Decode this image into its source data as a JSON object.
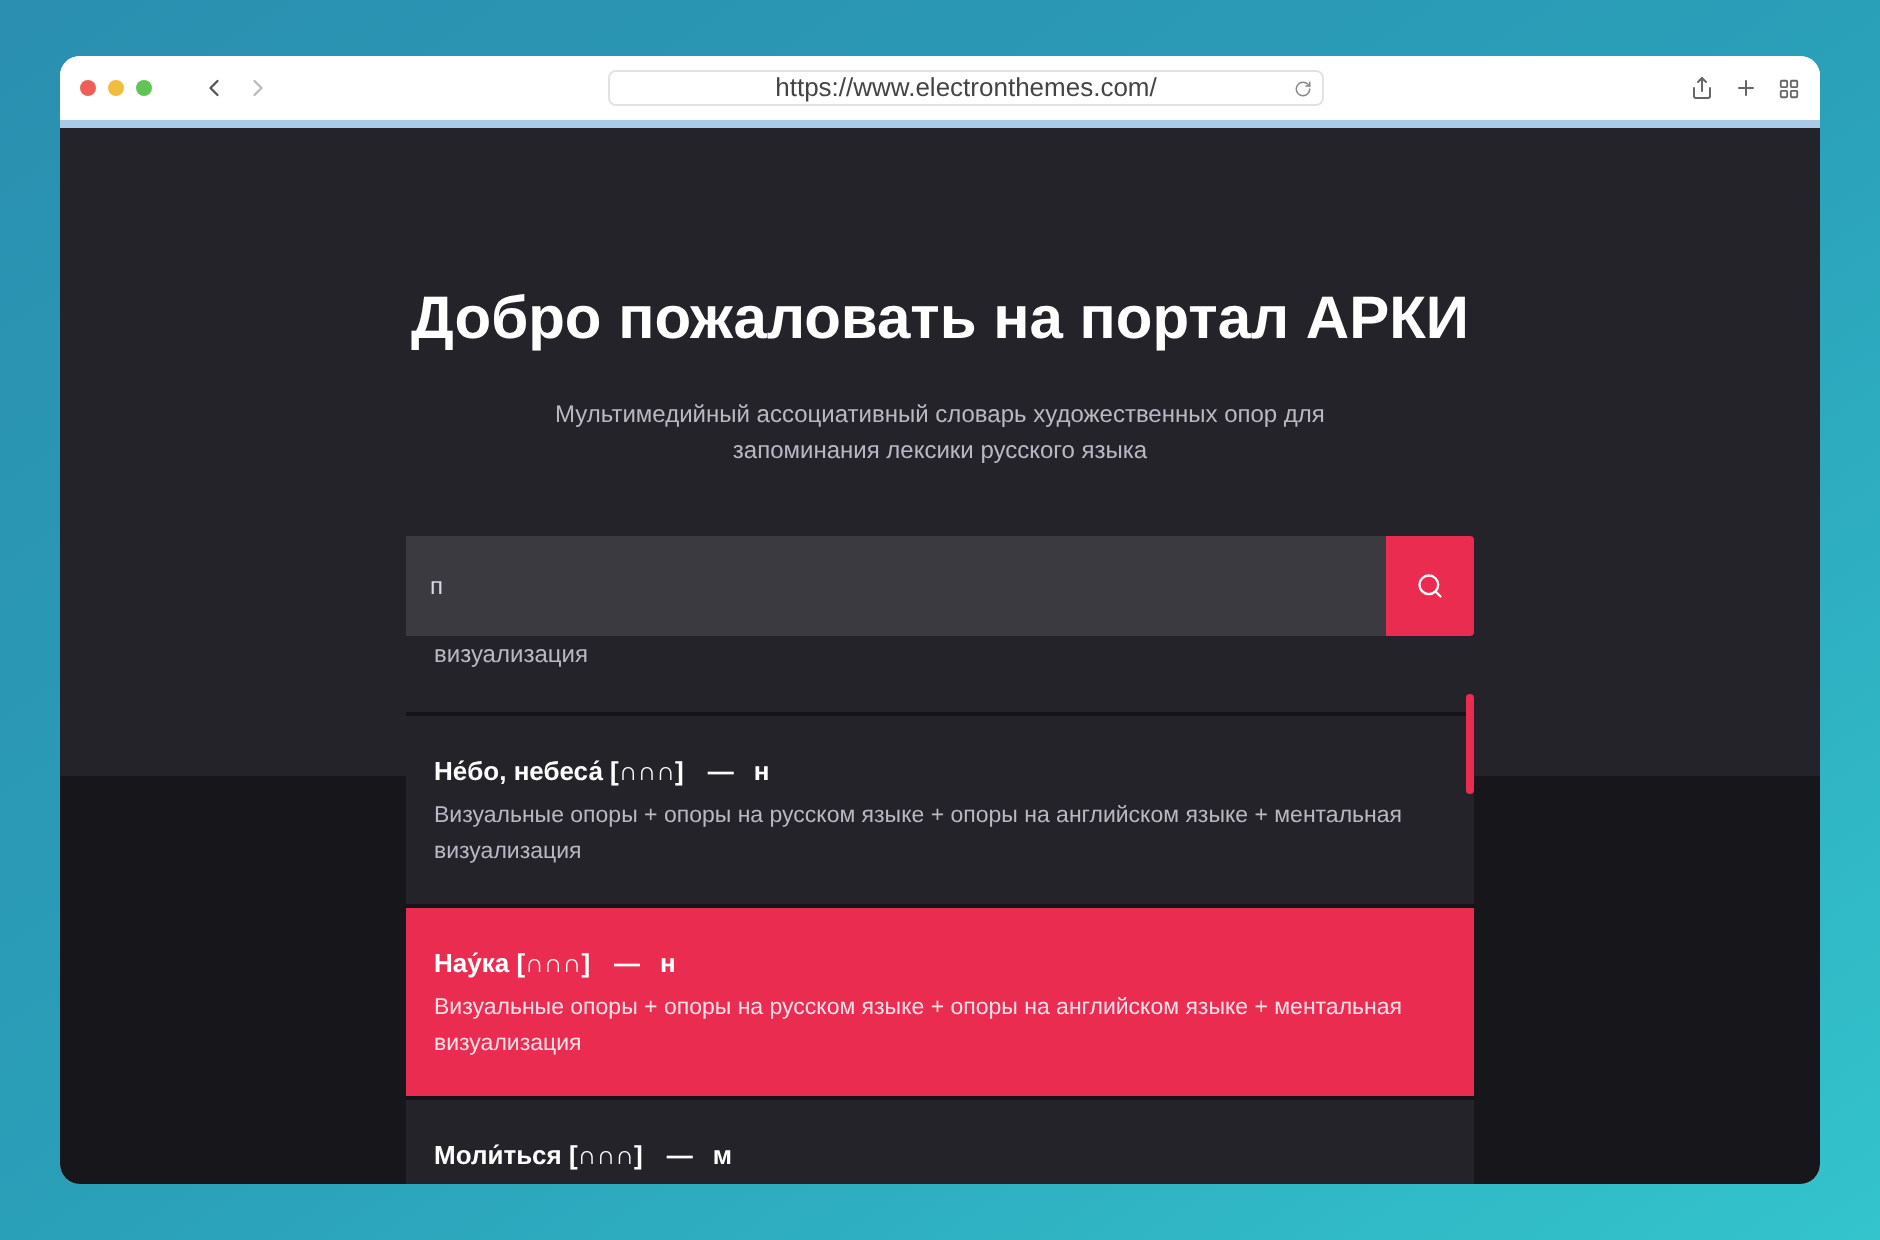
{
  "browser": {
    "url": "https://www.electronthemes.com/"
  },
  "hero": {
    "title": "Добро пожаловать на портал АРКИ",
    "subtitle": "Мультимедийный ассоциативный словарь художественных опор для запоминания лексики русского языка"
  },
  "search": {
    "value": "п"
  },
  "results": [
    {
      "kind": "partial",
      "description": "визуализация",
      "selected": false
    },
    {
      "kind": "full",
      "word": "Не́бо, небеса́ [∩∩∩]",
      "dash": "—",
      "gender": "н",
      "description": "Визуальные опоры + опоры на русском языке + опоры на английском языке + ментальная визуализация",
      "selected": false
    },
    {
      "kind": "full",
      "word": "Нау́ка [∩∩∩]",
      "dash": "—",
      "gender": "н",
      "description": "Визуальные опоры + опоры на русском языке + опоры на английском языке + ментальная визуализация",
      "selected": true
    },
    {
      "kind": "full",
      "word": "Моли́ться [∩∩∩]",
      "dash": "—",
      "gender": "м",
      "selected": false
    }
  ]
}
